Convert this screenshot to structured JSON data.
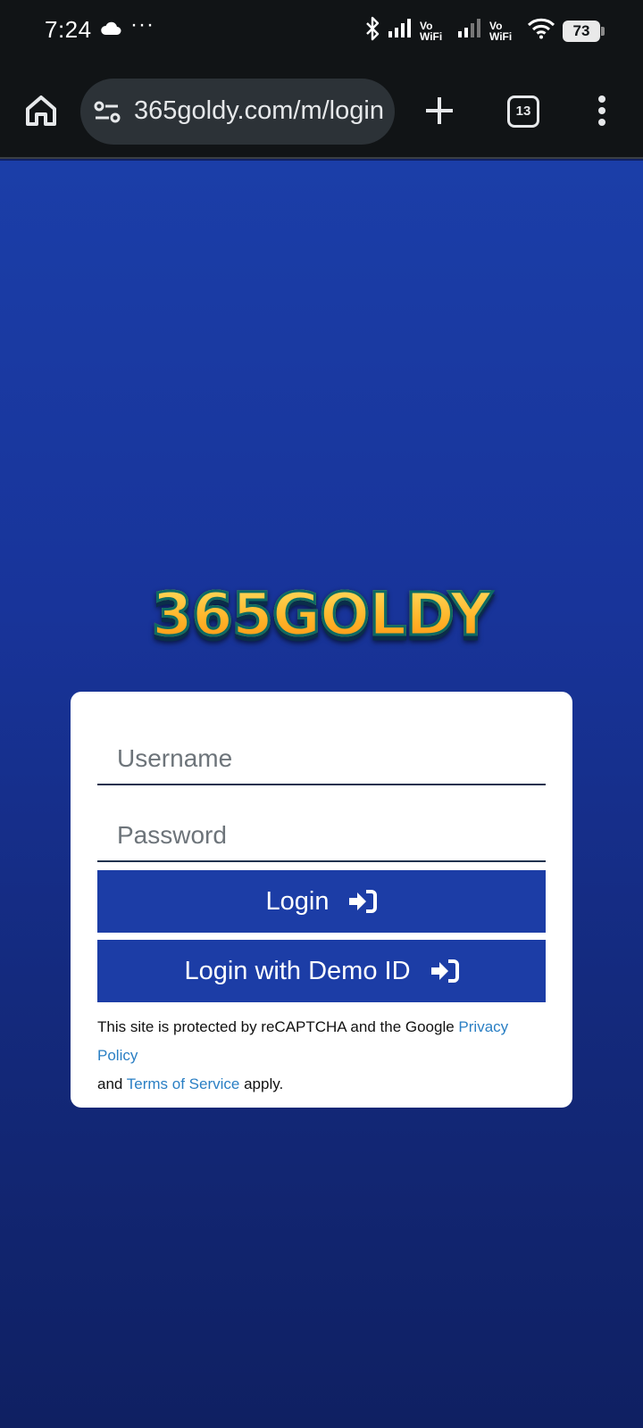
{
  "status_bar": {
    "time": "7:24",
    "dots": "···",
    "vowifi_top": "Vo",
    "vowifi_bottom": "WiFi",
    "battery": "73"
  },
  "browser": {
    "url": "365goldy.com/m/login",
    "tab_count": "13"
  },
  "logo": {
    "text": "365GOLDY"
  },
  "login_form": {
    "username_placeholder": "Username",
    "password_placeholder": "Password",
    "login_label": "Login",
    "demo_label": "Login with Demo ID",
    "recaptcha_prefix": "This site is protected by reCAPTCHA and the Google ",
    "privacy_link": "Privacy Policy",
    "recaptcha_and": " and ",
    "terms_link": "Terms of Service",
    "recaptcha_suffix": " apply."
  },
  "colors": {
    "button": "#1c3da6",
    "link": "#2a7fc4",
    "background_top": "#1b3ea8",
    "background_bottom": "#0f2062"
  }
}
